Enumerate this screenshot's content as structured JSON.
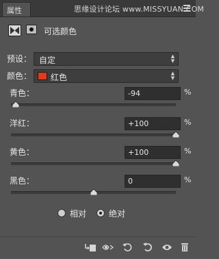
{
  "panel": {
    "tab_label": "属性",
    "watermark": "思缘设计论坛 www.MISSYUAN.COM"
  },
  "header": {
    "title": "可选颜色"
  },
  "preset": {
    "label": "预设：",
    "value": "自定"
  },
  "colors": {
    "label": "颜色：",
    "value": "红色",
    "swatch": "#e23a1e"
  },
  "sliders": [
    {
      "label": "青色：",
      "value": "-94",
      "unit": "%",
      "level_percent": -94
    },
    {
      "label": "洋红：",
      "value": "+100",
      "unit": "%",
      "level_percent": 100
    },
    {
      "label": "黄色：",
      "value": "+100",
      "unit": "%",
      "level_percent": 100
    },
    {
      "label": "黑色：",
      "value": "0",
      "unit": "%",
      "level_percent": 0
    }
  ],
  "method": {
    "options": [
      "相对",
      "绝对"
    ],
    "selected": "绝对"
  },
  "footer": {
    "icons": [
      "clip-to-layer-icon",
      "eye-preview-icon",
      "reset-previous-icon",
      "reset-default-icon",
      "visibility-eye-icon",
      "trash-icon"
    ]
  }
}
